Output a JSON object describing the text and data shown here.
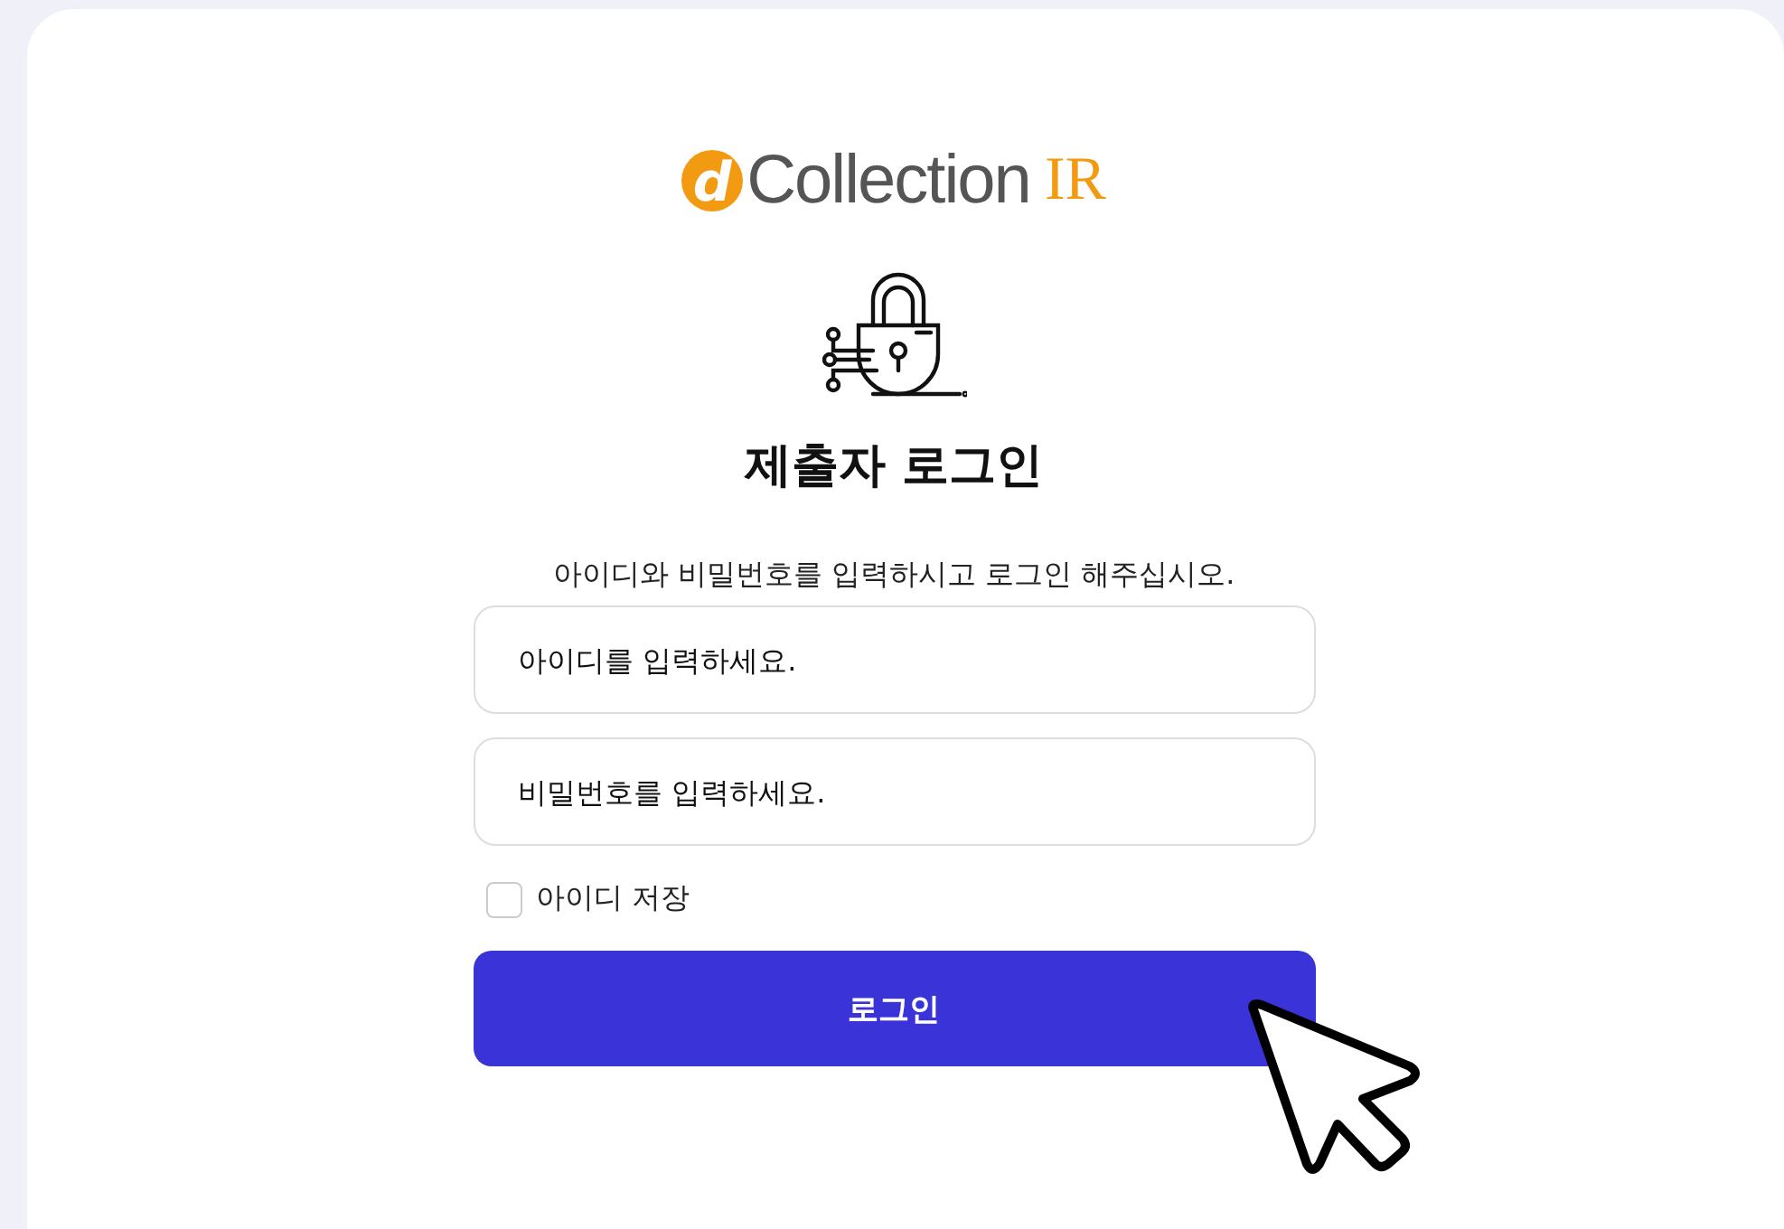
{
  "logo": {
    "mark": "d",
    "name": "Collection",
    "suffix": "IR"
  },
  "title": "제출자 로그인",
  "instruction": "아이디와 비밀번호를 입력하시고 로그인 해주십시오.",
  "fields": [
    {
      "placeholder": "아이디를 입력하세요."
    },
    {
      "placeholder": "비밀번호를 입력하세요."
    }
  ],
  "remember": {
    "label": "아이디 저장",
    "checked": false
  },
  "login_button": "로그인"
}
